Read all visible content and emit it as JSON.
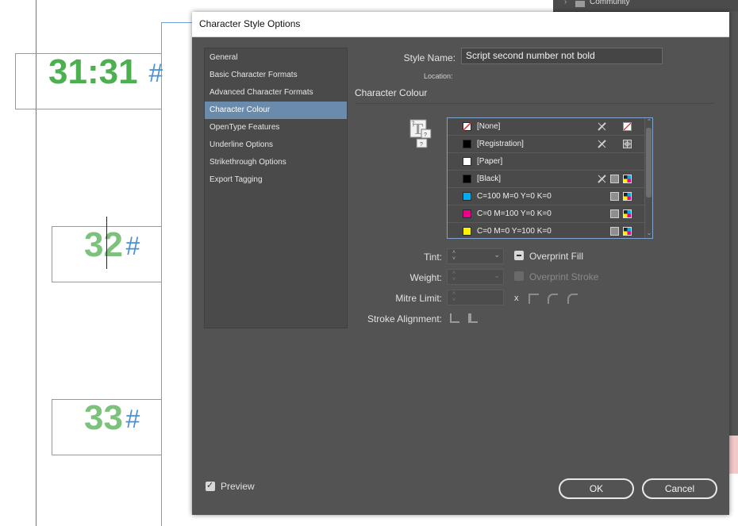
{
  "canvas": {
    "frames": [
      {
        "number": "31:31",
        "hash": "#"
      },
      {
        "number": "32",
        "hash": "#"
      },
      {
        "number": "33",
        "hash": "#"
      }
    ],
    "background_panel_label": "Community"
  },
  "dialog": {
    "title": "Character Style Options",
    "sidebar": [
      {
        "label": "General"
      },
      {
        "label": "Basic Character Formats"
      },
      {
        "label": "Advanced Character Formats"
      },
      {
        "label": "Character Colour",
        "selected": true
      },
      {
        "label": "OpenType Features"
      },
      {
        "label": "Underline Options"
      },
      {
        "label": "Strikethrough Options"
      },
      {
        "label": "Export Tagging"
      }
    ],
    "style_name_label": "Style Name:",
    "style_name_value": "Script second number not bold",
    "location_label": "Location:",
    "section_title": "Character Colour",
    "swatches": [
      {
        "name": "[None]",
        "color": "#ffffff"
      },
      {
        "name": "[Registration]",
        "color": "#000000"
      },
      {
        "name": "[Paper]",
        "color": "#ffffff"
      },
      {
        "name": "[Black]",
        "color": "#000000"
      },
      {
        "name": "C=100 M=0 Y=0 K=0",
        "color": "#00aeef"
      },
      {
        "name": "C=0 M=100 Y=0 K=0",
        "color": "#ec008c"
      },
      {
        "name": "C=0 M=0 Y=100 K=0",
        "color": "#fff200"
      }
    ],
    "tint_label": "Tint:",
    "weight_label": "Weight:",
    "mitre_label": "Mitre Limit:",
    "mitre_x": "x",
    "stroke_alignment_label": "Stroke Alignment:",
    "overprint_fill_label": "Overprint Fill",
    "overprint_stroke_label": "Overprint Stroke",
    "preview_label": "Preview",
    "ok_label": "OK",
    "cancel_label": "Cancel"
  }
}
